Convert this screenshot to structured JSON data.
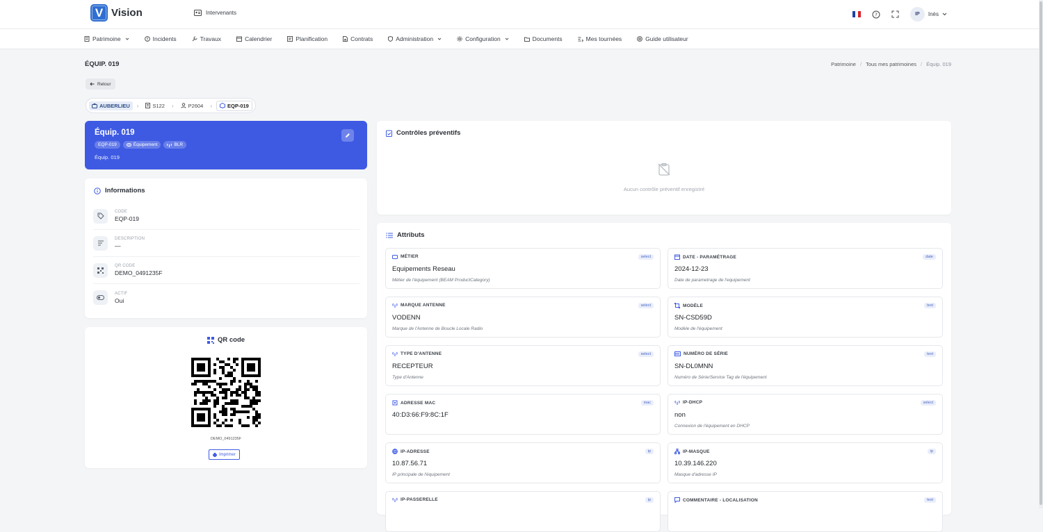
{
  "app": {
    "name": "Vision",
    "logo_letter": "V"
  },
  "topbar": {
    "intervenants": "Intervenants",
    "user_initials": "IP",
    "user_name": "Inès"
  },
  "nav": [
    {
      "label": "Patrimoine",
      "icon": "building-icon",
      "dropdown": true
    },
    {
      "label": "Incidents",
      "icon": "alert-icon",
      "dropdown": false
    },
    {
      "label": "Travaux",
      "icon": "wrench-icon",
      "dropdown": false
    },
    {
      "label": "Calendrier",
      "icon": "calendar-icon",
      "dropdown": false
    },
    {
      "label": "Planification",
      "icon": "planning-icon",
      "dropdown": false
    },
    {
      "label": "Contrats",
      "icon": "contract-icon",
      "dropdown": false
    },
    {
      "label": "Administration",
      "icon": "shield-icon",
      "dropdown": true
    },
    {
      "label": "Configuration",
      "icon": "gear-icon",
      "dropdown": true
    },
    {
      "label": "Documents",
      "icon": "folder-icon",
      "dropdown": false
    },
    {
      "label": "Mes tournées",
      "icon": "route-icon",
      "dropdown": false
    },
    {
      "label": "Guide utilisateur",
      "icon": "help-icon",
      "dropdown": false
    }
  ],
  "page": {
    "title": "ÉQUIP. 019",
    "back": "Retour"
  },
  "breadcrumb": [
    "Patrimoine",
    "Tous mes patrimoines",
    "Équip. 019"
  ],
  "path": [
    "AUBERLIEU",
    "S122",
    "P2604",
    "EQP-019"
  ],
  "hero": {
    "title": "Équip. 019",
    "tags": [
      "EQP-019",
      "Équipement",
      "BLR"
    ],
    "subtitle": "Équip. 019"
  },
  "info": {
    "title": "Informations",
    "rows": [
      {
        "label": "CODE",
        "value": "EQP-019"
      },
      {
        "label": "DESCRIPTION",
        "value": "—"
      },
      {
        "label": "QR CODE",
        "value": "DEMO_0491235F"
      },
      {
        "label": "ACTIF",
        "value": "Oui"
      }
    ]
  },
  "qr": {
    "title": "QR code",
    "code": "DEMO_0491235F",
    "print": "Imprimer"
  },
  "controls": {
    "title": "Contrôles préventifs",
    "empty": "Aucun contrôle préventif enregistré"
  },
  "attributes": {
    "title": "Attributs",
    "items": [
      {
        "label": "MÉTIER",
        "type": "select",
        "value": "Equipements Reseau",
        "desc": "Métier de l'équipement (BEAM ProductCategory)"
      },
      {
        "label": "DATE - PARAMÉTRAGE",
        "type": "date",
        "value": "2024-12-23",
        "desc": "Date de parametrage de l'equipement"
      },
      {
        "label": "MARQUE ANTENNE",
        "type": "select",
        "value": "VODENN",
        "desc": "Marque de l'Antenne de Boucle Locale Radio"
      },
      {
        "label": "MODÈLE",
        "type": "text",
        "value": "SN-CSD59D",
        "desc": "Modèle de l'équipement"
      },
      {
        "label": "TYPE D'ANTENNE",
        "type": "select",
        "value": "RECEPTEUR",
        "desc": "Type d'Antenne"
      },
      {
        "label": "NUMÉRO DE SÉRIE",
        "type": "text",
        "value": "SN-DL0MNN",
        "desc": "Numéro de Série/Service Tag de l'équipement"
      },
      {
        "label": "ADRESSE MAC",
        "type": "mac",
        "value": "40:D3:66:F9:8C:1F",
        "desc": ""
      },
      {
        "label": "IP-DHCP",
        "type": "select",
        "value": "non",
        "desc": "Connexion de l'équipement en DHCP"
      },
      {
        "label": "IP-ADRESSE",
        "type": "ip",
        "value": "10.87.56.71",
        "desc": "IP principale de l'équipement"
      },
      {
        "label": "IP-MASQUE",
        "type": "ip",
        "value": "10.39.146.220",
        "desc": "Masque d'adresse IP"
      },
      {
        "label": "IP-PASSERELLE",
        "type": "ip",
        "value": "",
        "desc": ""
      },
      {
        "label": "COMMENTAIRE - LOCALISATION",
        "type": "text",
        "value": "",
        "desc": ""
      }
    ]
  },
  "colors": {
    "primary": "#3e5ae3",
    "background": "#f4f5f7",
    "logo": "#2f6fd1"
  }
}
